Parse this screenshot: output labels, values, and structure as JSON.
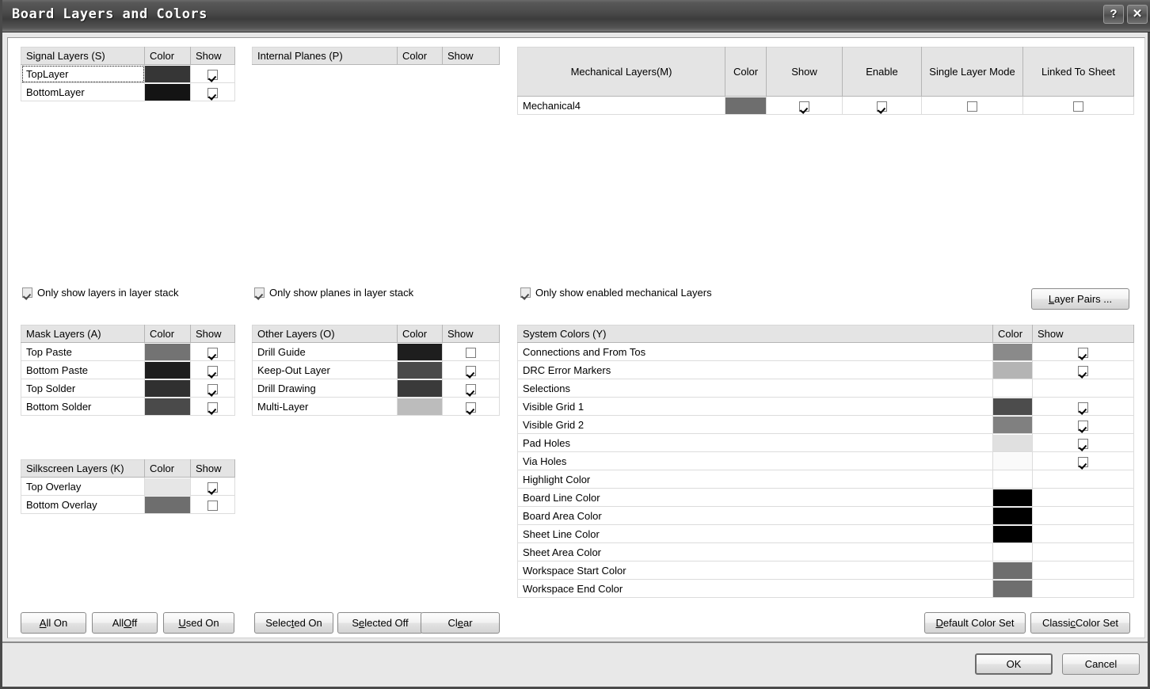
{
  "window": {
    "title": "Board Layers and Colors",
    "help_button": "?",
    "close_button": "✕"
  },
  "signal_layers": {
    "headers": [
      "Signal Layers (S)",
      "Color",
      "Show"
    ],
    "rows": [
      {
        "name": "TopLayer",
        "color": "#363636",
        "show": true,
        "focused": true
      },
      {
        "name": "BottomLayer",
        "color": "#141414",
        "show": true,
        "focused": false
      }
    ]
  },
  "internal_planes": {
    "headers": [
      "Internal Planes (P)",
      "Color",
      "Show"
    ],
    "rows": []
  },
  "mechanical_layers": {
    "headers": [
      "Mechanical Layers(M)",
      "Color",
      "Show",
      "Enable",
      "Single Layer Mode",
      "Linked To Sheet"
    ],
    "rows": [
      {
        "name": "Mechanical4",
        "color": "#6e6e6e",
        "show": true,
        "enable": true,
        "single_layer_mode": false,
        "linked_to_sheet": false
      }
    ]
  },
  "options": {
    "only_layers": {
      "label": "Only show layers in layer stack",
      "checked": true
    },
    "only_planes": {
      "label": "Only show planes in layer stack",
      "checked": true
    },
    "only_mechanical": {
      "label": "Only show enabled mechanical Layers",
      "checked": true
    }
  },
  "layer_pairs_button": {
    "accel": "L",
    "rest": "ayer Pairs ..."
  },
  "mask_layers": {
    "headers": [
      "Mask Layers (A)",
      "Color",
      "Show"
    ],
    "rows": [
      {
        "name": "Top Paste",
        "color": "#737373",
        "show": true
      },
      {
        "name": "Bottom Paste",
        "color": "#1e1e1e",
        "show": true
      },
      {
        "name": "Top Solder",
        "color": "#303030",
        "show": true
      },
      {
        "name": "Bottom Solder",
        "color": "#4a4a4a",
        "show": true
      }
    ]
  },
  "other_layers": {
    "headers": [
      "Other Layers (O)",
      "Color",
      "Show"
    ],
    "rows": [
      {
        "name": "Drill Guide",
        "color": "#1e1e1e",
        "show": false
      },
      {
        "name": "Keep-Out Layer",
        "color": "#4a4a4a",
        "show": true
      },
      {
        "name": "Drill Drawing",
        "color": "#3a3a3a",
        "show": true
      },
      {
        "name": "Multi-Layer",
        "color": "#bcbcbc",
        "show": true
      }
    ]
  },
  "silkscreen_layers": {
    "headers": [
      "Silkscreen Layers (K)",
      "Color",
      "Show"
    ],
    "rows": [
      {
        "name": "Top Overlay",
        "color": "#e6e6e6",
        "show": true
      },
      {
        "name": "Bottom Overlay",
        "color": "#6e6e6e",
        "show": false
      }
    ]
  },
  "system_colors": {
    "headers": [
      "System Colors (Y)",
      "Color",
      "Show"
    ],
    "rows": [
      {
        "name": "Connections and From Tos",
        "color": "#8a8a8a",
        "show": true
      },
      {
        "name": "DRC Error Markers",
        "color": "#b4b4b4",
        "show": true
      },
      {
        "name": "Selections",
        "color": "",
        "show": null
      },
      {
        "name": "Visible Grid 1",
        "color": "#4c4c4c",
        "show": true
      },
      {
        "name": "Visible Grid 2",
        "color": "#808080",
        "show": true
      },
      {
        "name": "Pad Holes",
        "color": "#e0e0e0",
        "show": true
      },
      {
        "name": "Via Holes",
        "color": "#fafafa",
        "show": true
      },
      {
        "name": "Highlight Color",
        "color": "",
        "show": null
      },
      {
        "name": "Board Line Color",
        "color": "#000000",
        "show": null
      },
      {
        "name": "Board Area Color",
        "color": "#000000",
        "show": null
      },
      {
        "name": "Sheet Line Color",
        "color": "#000000",
        "show": null
      },
      {
        "name": "Sheet Area Color",
        "color": "",
        "show": null
      },
      {
        "name": "Workspace Start Color",
        "color": "#6e6e6e",
        "show": null
      },
      {
        "name": "Workspace End Color",
        "color": "#6e6e6e",
        "show": null
      }
    ]
  },
  "action_buttons": [
    {
      "name": "all-on",
      "accel": "A",
      "pre": "",
      "rest": "ll On"
    },
    {
      "name": "all-off",
      "accel": "O",
      "pre": "All ",
      "rest": "ff"
    },
    {
      "name": "used-on",
      "accel": "U",
      "pre": "",
      "rest": "sed On"
    },
    {
      "name": "selected-on",
      "accel": "t",
      "pre": "Selec",
      "rest": "ed On"
    },
    {
      "name": "selected-off",
      "accel": "e",
      "pre": "S",
      "rest": "lected Off"
    },
    {
      "name": "clear",
      "accel": "e",
      "pre": "Cl",
      "rest": "ar"
    }
  ],
  "color_set_buttons": [
    {
      "name": "default-color-set",
      "accel": "D",
      "pre": "",
      "rest": "efault Color Set"
    },
    {
      "name": "classic-color-set",
      "accel": "c",
      "pre": "Classi",
      "rest": " Color Set"
    }
  ],
  "footer_buttons": {
    "ok": "OK",
    "cancel": "Cancel"
  }
}
